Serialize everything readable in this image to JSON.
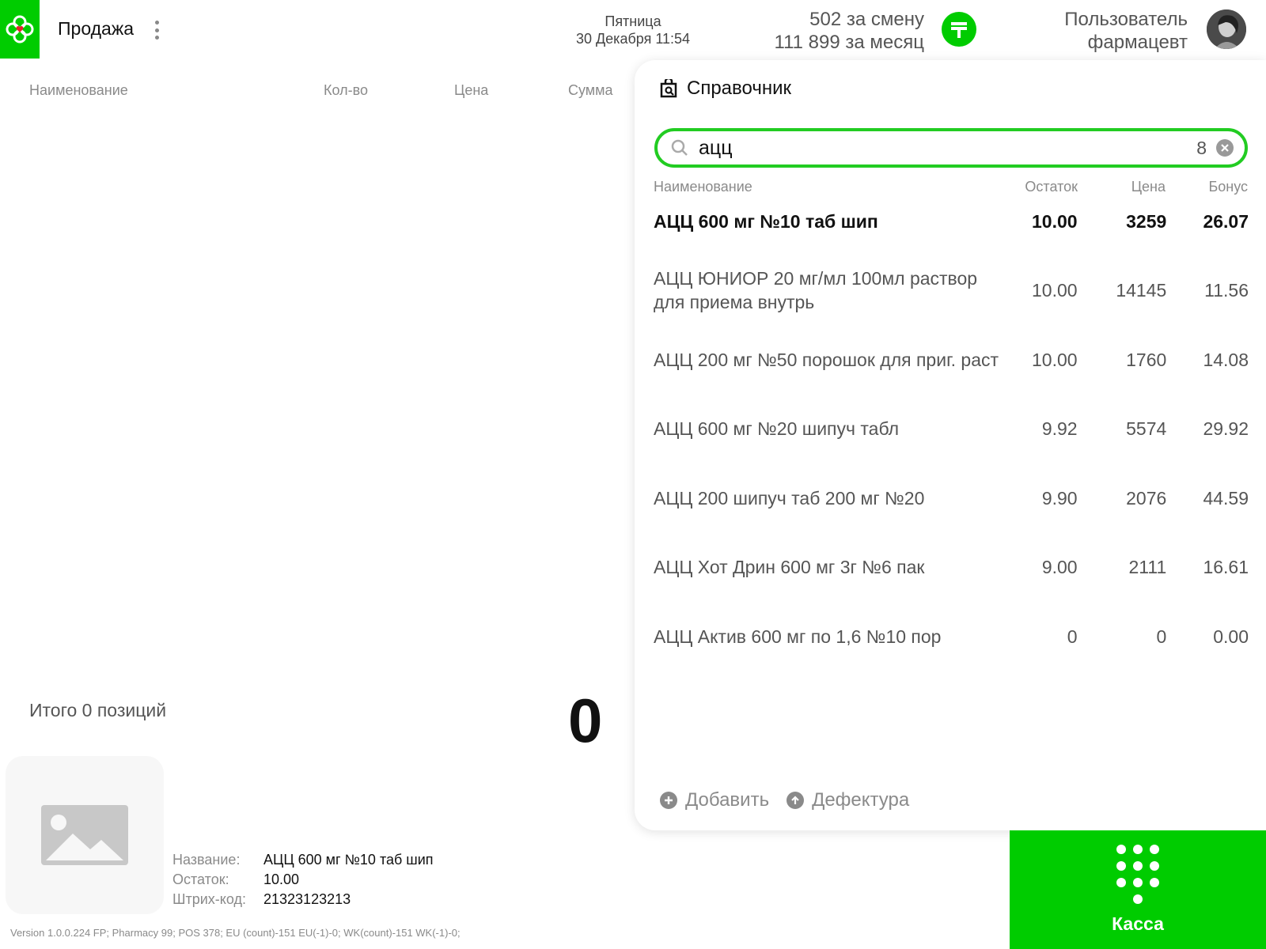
{
  "header": {
    "page_title": "Продажа",
    "day": "Пятница",
    "datetime": "30 Декабря 11:54",
    "shift_stat": "502 за смену",
    "month_stat": "111 899 за месяц",
    "user_name": "Пользователь",
    "user_role": "фармацевт"
  },
  "sale": {
    "columns": [
      "Наименование",
      "Кол-во",
      "Цена",
      "Сумма"
    ],
    "total_label": "Итого 0 позиций",
    "total_value": "0"
  },
  "product_info": {
    "name_label": "Название:",
    "name_value": "АЦЦ 600 мг №10 таб шип",
    "stock_label": "Остаток:",
    "stock_value": "10.00",
    "barcode_label": "Штрих-код:",
    "barcode_value": "21323123213"
  },
  "footer": {
    "version": "Version 1.0.0.224 FP;   Pharmacy 99;   POS 378;   EU (count)-151 EU(-1)-0;   WK(count)-151 WK(-1)-0;"
  },
  "reference": {
    "title": "Справочник",
    "search_value": "ацц",
    "result_count": "8",
    "columns": {
      "name": "Наименование",
      "stock": "Остаток",
      "price": "Цена",
      "bonus": "Бонус"
    },
    "rows": [
      {
        "name": "АЦЦ 600 мг №10 таб шип",
        "stock": "10.00",
        "price": "3259",
        "bonus": "26.07"
      },
      {
        "name": "АЦЦ ЮНИОР 20 мг/мл 100мл раствор для приема внутрь",
        "stock": "10.00",
        "price": "14145",
        "bonus": "11.56"
      },
      {
        "name": "АЦЦ 200 мг №50 порошок для приг. раст",
        "stock": "10.00",
        "price": "1760",
        "bonus": "14.08"
      },
      {
        "name": "АЦЦ 600 мг №20 шипуч табл",
        "stock": "9.92",
        "price": "5574",
        "bonus": "29.92"
      },
      {
        "name": "АЦЦ 200 шипуч таб 200 мг №20",
        "stock": "9.90",
        "price": "2076",
        "bonus": "44.59"
      },
      {
        "name": "АЦЦ Хот Дрин 600 мг 3г №6 пак",
        "stock": "9.00",
        "price": "2111",
        "bonus": "16.61"
      },
      {
        "name": "АЦЦ Актив 600 мг по 1,6 №10 пор",
        "stock": "0",
        "price": "0",
        "bonus": "0.00"
      }
    ],
    "add_label": "Добавить",
    "defect_label": "Дефектура"
  },
  "kassa": {
    "label": "Касса"
  },
  "colors": {
    "brand": "#00cc00",
    "search_border": "#22cc22",
    "muted": "#8a8a8a"
  },
  "icons": [
    "clover-logo-icon",
    "kebab-menu-icon",
    "coin-icon",
    "avatar",
    "catalog-icon",
    "search-icon",
    "clear-icon",
    "plus-circle-icon",
    "arrow-up-circle-icon",
    "keypad-icon",
    "image-placeholder-icon"
  ]
}
